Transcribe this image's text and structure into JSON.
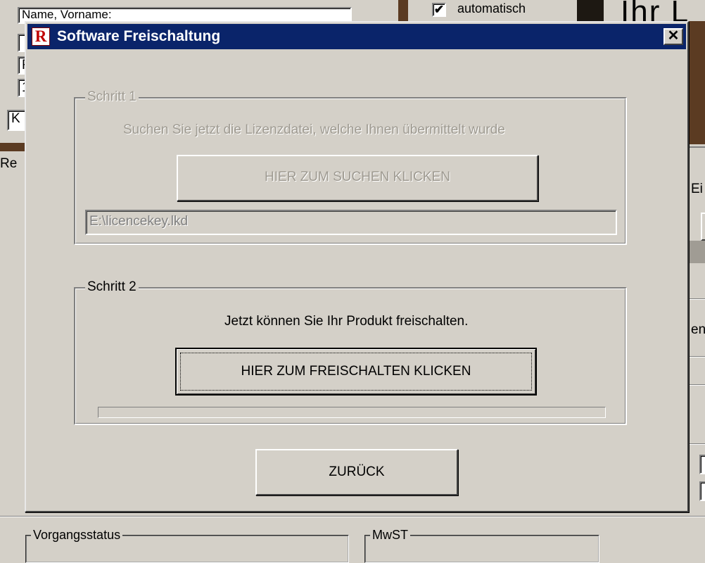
{
  "background": {
    "fields": [
      "Name, Vorname:",
      "",
      "F",
      "1",
      "K"
    ],
    "checkbox_mark": "✔",
    "checkbox_label": "automatisch",
    "big_heading": "Ihr L",
    "left_label": "Re",
    "right_labels": [
      "Ei",
      "en:"
    ],
    "group_vorgangsstatus": "Vorgangsstatus",
    "group_mwst": "MwST"
  },
  "dialog": {
    "title": "Software Freischaltung",
    "icon_glyph": "R",
    "close_glyph": "✕",
    "step1": {
      "legend": "Schritt 1",
      "instruction": "Suchen Sie jetzt die Lizenzdatei, welche Ihnen übermittelt wurde",
      "button_label": "HIER ZUM SUCHEN KLICKEN",
      "path_value": "E:\\licencekey.lkd"
    },
    "step2": {
      "legend": "Schritt 2",
      "instruction": "Jetzt  können Sie Ihr Produkt freischalten.",
      "button_label": "HIER ZUM FREISCHALTEN KLICKEN",
      "progress": 0
    },
    "back_label": "ZURÜCK"
  },
  "colors": {
    "titlebar": "#0a246a",
    "face": "#d4d0c8",
    "icon_red": "#c00000"
  }
}
